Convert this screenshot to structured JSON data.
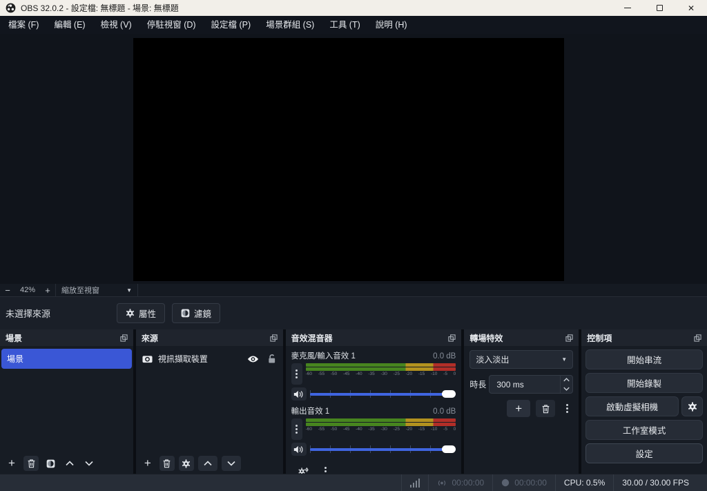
{
  "window": {
    "title": "OBS 32.0.2 - 設定檔: 無標題 - 場景: 無標題",
    "close_glyph": "✕"
  },
  "menu": {
    "items": [
      "檔案 (F)",
      "編輯 (E)",
      "檢視 (V)",
      "停駐視窗 (D)",
      "設定檔 (P)",
      "場景群組 (S)",
      "工具 (T)",
      "說明 (H)"
    ]
  },
  "preview": {
    "zoom_out": "−",
    "zoom_level": "42%",
    "zoom_in": "+",
    "zoom_mode": "縮放至視窗",
    "dropdown_arrow": "▼",
    "no_source": "未選擇來源",
    "properties_label": "屬性",
    "filters_label": "濾鏡"
  },
  "panels": {
    "scenes": {
      "title": "場景",
      "items": [
        {
          "label": "場景"
        }
      ]
    },
    "sources": {
      "title": "來源",
      "items": [
        {
          "label": "視訊擷取裝置"
        }
      ]
    },
    "mixer": {
      "title": "音效混音器",
      "channels": [
        {
          "name": "麥克風/輸入音效 1",
          "level": "0.0 dB"
        },
        {
          "name": "輸出音效 1",
          "level": "0.0 dB"
        }
      ],
      "scale": [
        "-60",
        "-55",
        "-50",
        "-45",
        "-40",
        "-35",
        "-30",
        "-25",
        "-20",
        "-15",
        "-10",
        "-5",
        "0"
      ]
    },
    "transitions": {
      "title": "轉場特效",
      "current": "淡入淡出",
      "duration_label": "時長",
      "duration_value": "300 ms",
      "add_glyph": "+"
    },
    "controls": {
      "title": "控制項",
      "buttons": [
        "開始串流",
        "開始錄製",
        "啟動虛擬相機",
        "工作室模式",
        "設定"
      ]
    }
  },
  "statusbar": {
    "stream_time": "00:00:00",
    "record_time": "00:00:00",
    "cpu": "CPU: 0.5%",
    "fps": "30.00 / 30.00 FPS"
  },
  "ui": {
    "plus": "+"
  },
  "colors": {
    "titlebar_bg": "#f2efe9",
    "selection_blue": "#3a57d6",
    "slider_blue": "#3f65e0",
    "meter_green": "#47851f",
    "meter_yellow": "#b3921f",
    "meter_red": "#b12e28",
    "panel_bg": "#171c24",
    "statusbar_bg": "#272d37"
  }
}
